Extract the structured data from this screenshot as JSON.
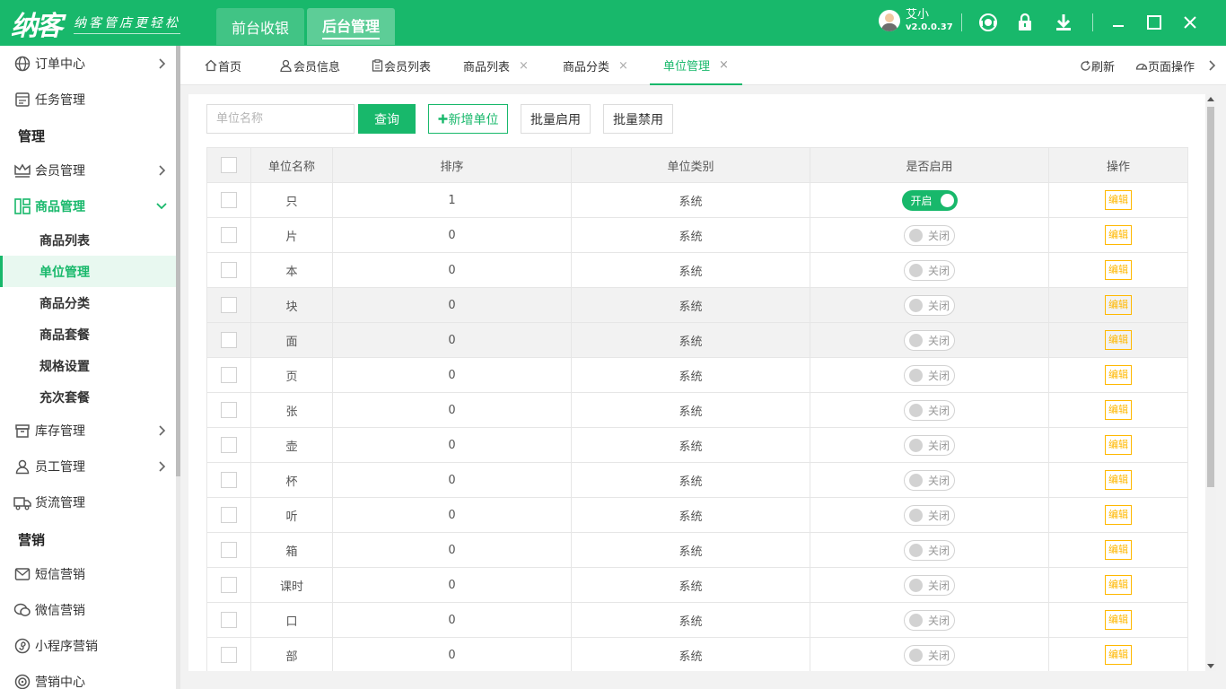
{
  "app": {
    "logo": "纳客",
    "slogan": "纳客管店更轻松",
    "top_tabs": [
      "前台收银",
      "后台管理"
    ],
    "active_top_tab": "后台管理",
    "user_name": "艾小",
    "version": "v2.0.0.37",
    "accent_color": "#18b86b",
    "warn_color": "#ffb800",
    "top_icons": [
      "support-icon",
      "lock-icon",
      "download-icon",
      "minimize-icon",
      "maximize-icon",
      "close-icon"
    ]
  },
  "sidebar": {
    "items": [
      {
        "label": "订单中心",
        "icon": "globe-icon",
        "arrow": "right"
      },
      {
        "label": "任务管理",
        "icon": "task-icon"
      },
      {
        "section": "管理"
      },
      {
        "label": "会员管理",
        "icon": "crown-icon",
        "arrow": "right"
      },
      {
        "label": "商品管理",
        "icon": "goods-icon",
        "arrow": "down",
        "expanded": true
      },
      {
        "label": "库存管理",
        "icon": "box-icon",
        "arrow": "right"
      },
      {
        "label": "员工管理",
        "icon": "person-icon",
        "arrow": "right"
      },
      {
        "label": "货流管理",
        "icon": "truck-icon"
      },
      {
        "section": "营销"
      },
      {
        "label": "短信营销",
        "icon": "mail-icon"
      },
      {
        "label": "微信营销",
        "icon": "wechat-icon"
      },
      {
        "label": "小程序营销",
        "icon": "miniapp-icon"
      },
      {
        "label": "营销中心",
        "icon": "target-icon"
      }
    ],
    "sub_items": [
      "商品列表",
      "单位管理",
      "商品分类",
      "商品套餐",
      "规格设置",
      "充次套餐"
    ],
    "active_sub": "单位管理"
  },
  "tabs": {
    "items": [
      {
        "label": "首页",
        "icon": "home-icon"
      },
      {
        "label": "会员信息",
        "icon": "user-icon"
      },
      {
        "label": "会员列表",
        "icon": "clipboard-icon"
      },
      {
        "label": "商品列表",
        "closable": true
      },
      {
        "label": "商品分类",
        "closable": true
      },
      {
        "label": "单位管理",
        "closable": true,
        "active": true
      }
    ],
    "close_glyph": "×",
    "refresh_label": "刷新",
    "page_ops_label": "页面操作"
  },
  "toolbar": {
    "search_placeholder": "单位名称",
    "query_label": "查询",
    "add_label": "新增单位",
    "enable_label": "批量启用",
    "disable_label": "批量禁用"
  },
  "table": {
    "columns": [
      "单位名称",
      "排序",
      "单位类别",
      "是否启用",
      "操作"
    ],
    "on_label": "开启",
    "off_label": "关闭",
    "edit_label": "编辑",
    "rows": [
      {
        "name": "只",
        "sort": "1",
        "type": "系统",
        "enabled": true
      },
      {
        "name": "片",
        "sort": "0",
        "type": "系统",
        "enabled": false
      },
      {
        "name": "本",
        "sort": "0",
        "type": "系统",
        "enabled": false
      },
      {
        "name": "块",
        "sort": "0",
        "type": "系统",
        "enabled": false,
        "highlight": true
      },
      {
        "name": "面",
        "sort": "0",
        "type": "系统",
        "enabled": false,
        "highlight": true
      },
      {
        "name": "页",
        "sort": "0",
        "type": "系统",
        "enabled": false
      },
      {
        "name": "张",
        "sort": "0",
        "type": "系统",
        "enabled": false
      },
      {
        "name": "壶",
        "sort": "0",
        "type": "系统",
        "enabled": false
      },
      {
        "name": "杯",
        "sort": "0",
        "type": "系统",
        "enabled": false
      },
      {
        "name": "听",
        "sort": "0",
        "type": "系统",
        "enabled": false
      },
      {
        "name": "箱",
        "sort": "0",
        "type": "系统",
        "enabled": false
      },
      {
        "name": "课时",
        "sort": "0",
        "type": "系统",
        "enabled": false
      },
      {
        "name": "口",
        "sort": "0",
        "type": "系统",
        "enabled": false
      },
      {
        "name": "部",
        "sort": "0",
        "type": "系统",
        "enabled": false
      }
    ]
  }
}
